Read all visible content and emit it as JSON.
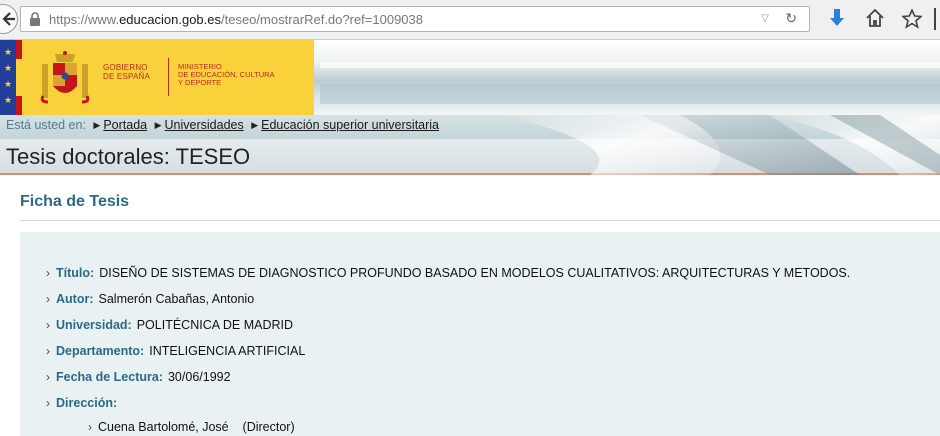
{
  "browser": {
    "url_scheme": "https://www.",
    "url_domain": "educacion.gob.es",
    "url_path": "/teseo/mostrarRef.do?ref=1009038"
  },
  "header": {
    "gov_line1": "GOBIERNO",
    "gov_line2": "DE ESPAÑA",
    "min_line1": "MINISTERIO",
    "min_line2": "DE EDUCACIÓN, CULTURA",
    "min_line3": "Y DEPORTE"
  },
  "breadcrumb": {
    "prefix": "Está usted en:",
    "items": [
      "Portada",
      "Universidades",
      "Educación superior universitaria"
    ]
  },
  "page": {
    "title": "Tesis doctorales: TESEO",
    "section_title": "Ficha de Tesis"
  },
  "fields": [
    {
      "label": "Título:",
      "value": "DISEÑO DE SISTEMAS DE DIAGNOSTICO PROFUNDO BASADO EN MODELOS CUALITATIVOS: ARQUITECTURAS Y METODOS."
    },
    {
      "label": "Autor:",
      "value": "Salmerón Cabañas, Antonio"
    },
    {
      "label": "Universidad:",
      "value": "POLITÉCNICA DE MADRID"
    },
    {
      "label": "Departamento:",
      "value": "INTELIGENCIA ARTIFICIAL"
    },
    {
      "label": "Fecha de Lectura:",
      "value": "30/06/1992"
    },
    {
      "label": "Dirección:",
      "value": ""
    }
  ],
  "direction": [
    {
      "name": "Cuena Bartolomé, José",
      "role": "(Director)"
    }
  ],
  "colors": {
    "accent": "#2b6a85",
    "gov_yellow": "#f9d13b",
    "gov_red": "#c02a1f"
  }
}
